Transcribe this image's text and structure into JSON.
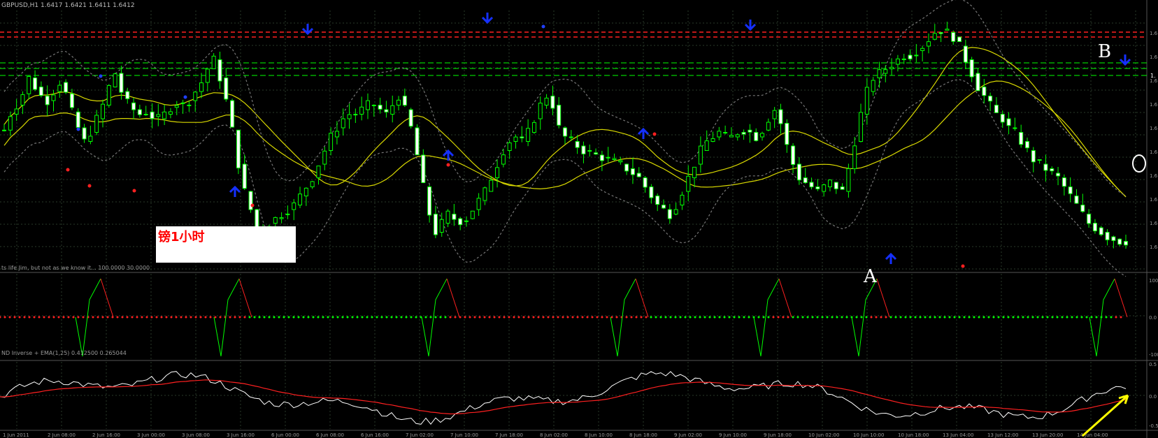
{
  "window": {
    "header_text": "GBPUSD,H1 1.6417 1.6421 1.6411 1.6412",
    "note_text": "镑1小时",
    "marker_a": "A",
    "marker_b": "B",
    "right_tag": "1."
  },
  "colors": {
    "background": "#000000",
    "grid": "#2a3a2a",
    "bull_candle": "#00ff00",
    "bear_candle_fill": "#ffffff",
    "ma_band": "#d8d800",
    "resistance_red": "#ff2020",
    "support_green": "#00ff00",
    "arrow_blue": "#1530ff",
    "dot_red": "#ff2020",
    "dot_blue": "#2040ff",
    "osc_up": "#00ff00",
    "osc_down": "#ff2020",
    "osc2_line": "#ffffff",
    "osc2_ema": "#ff2020",
    "arrow_yellow": "#ffff00"
  },
  "chart_data": [
    {
      "type": "candlestick",
      "symbol": "GBPUSD",
      "timeframe": "H1",
      "ohlc_header": "GBPUSD,H1 1.6417 1.6421 1.6411 1.6412",
      "x_ticks": [
        "1 Jun 2011",
        "2 Jun 08:00",
        "2 Jun 16:00",
        "3 Jun 00:00",
        "3 Jun 08:00",
        "3 Jun 16:00",
        "6 Jun 00:00",
        "6 Jun 08:00",
        "6 Jun 16:00",
        "7 Jun 02:00",
        "7 Jun 10:00",
        "7 Jun 18:00",
        "8 Jun 02:00",
        "8 Jun 10:00",
        "8 Jun 18:00",
        "9 Jun 02:00",
        "9 Jun 10:00",
        "9 Jun 18:00",
        "10 Jun 02:00",
        "10 Jun 10:00",
        "10 Jun 18:00",
        "13 Jun 04:00",
        "13 Jun 12:00",
        "13 Jun 20:00",
        "14 Jun 04:00"
      ],
      "y_ticks": [
        "1.6",
        "1.6",
        "1.6",
        "1.6",
        "1.6",
        "1.6",
        "1.6",
        "1.6",
        "1.6",
        "1.6"
      ],
      "close_path": [
        0.55,
        0.62,
        0.66,
        0.71,
        0.78,
        0.74,
        0.7,
        0.68,
        0.72,
        0.76,
        0.71,
        0.63,
        0.56,
        0.5,
        0.54,
        0.6,
        0.66,
        0.74,
        0.8,
        0.72,
        0.67,
        0.64,
        0.62,
        0.63,
        0.61,
        0.6,
        0.62,
        0.65,
        0.67,
        0.66,
        0.68,
        0.72,
        0.76,
        0.82,
        0.86,
        0.78,
        0.68,
        0.55,
        0.4,
        0.28,
        0.2,
        0.12,
        0.1,
        0.14,
        0.16,
        0.18,
        0.2,
        0.22,
        0.26,
        0.3,
        0.34,
        0.4,
        0.46,
        0.52,
        0.56,
        0.6,
        0.62,
        0.62,
        0.64,
        0.66,
        0.66,
        0.64,
        0.62,
        0.66,
        0.7,
        0.64,
        0.56,
        0.44,
        0.3,
        0.18,
        0.1,
        0.14,
        0.18,
        0.16,
        0.15,
        0.16,
        0.2,
        0.24,
        0.28,
        0.34,
        0.4,
        0.46,
        0.5,
        0.52,
        0.5,
        0.54,
        0.6,
        0.66,
        0.7,
        0.66,
        0.56,
        0.52,
        0.5,
        0.48,
        0.46,
        0.45,
        0.44,
        0.43,
        0.42,
        0.41,
        0.4,
        0.38,
        0.36,
        0.34,
        0.3,
        0.26,
        0.22,
        0.2,
        0.18,
        0.22,
        0.28,
        0.34,
        0.4,
        0.46,
        0.5,
        0.52,
        0.54,
        0.52,
        0.52,
        0.54,
        0.55,
        0.54,
        0.52,
        0.55,
        0.6,
        0.64,
        0.58,
        0.48,
        0.4,
        0.34,
        0.32,
        0.3,
        0.28,
        0.3,
        0.32,
        0.3,
        0.28,
        0.38,
        0.5,
        0.62,
        0.72,
        0.78,
        0.8,
        0.82,
        0.84,
        0.86,
        0.88,
        0.88,
        0.9,
        0.92,
        0.95,
        0.98,
        0.99,
        0.98,
        0.96,
        0.92,
        0.86,
        0.8,
        0.74,
        0.7,
        0.66,
        0.62,
        0.6,
        0.56,
        0.54,
        0.5,
        0.46,
        0.42,
        0.4,
        0.38,
        0.36,
        0.34,
        0.3,
        0.26,
        0.22,
        0.18,
        0.14,
        0.12,
        0.1,
        0.08,
        0.07,
        0.06,
        0.06
      ],
      "annotations": [
        "A",
        "B",
        "镑1小时"
      ]
    },
    {
      "type": "line",
      "name": "panel-2-oscillator",
      "legend_text": "ts life Jim, but not as we know it... 100.0000 30.0000",
      "y_ticks": [
        "100",
        "0.0",
        "-100"
      ],
      "ylim": [
        -100,
        100
      ]
    },
    {
      "type": "line",
      "name": "panel-3-oscillator",
      "legend_text": "ND Inverse + EMA(1,25) 0.412500 0.265044",
      "y_ticks": [
        "0.5",
        "0.0",
        "-0.5"
      ],
      "ylim": [
        -0.5,
        0.5
      ]
    }
  ]
}
